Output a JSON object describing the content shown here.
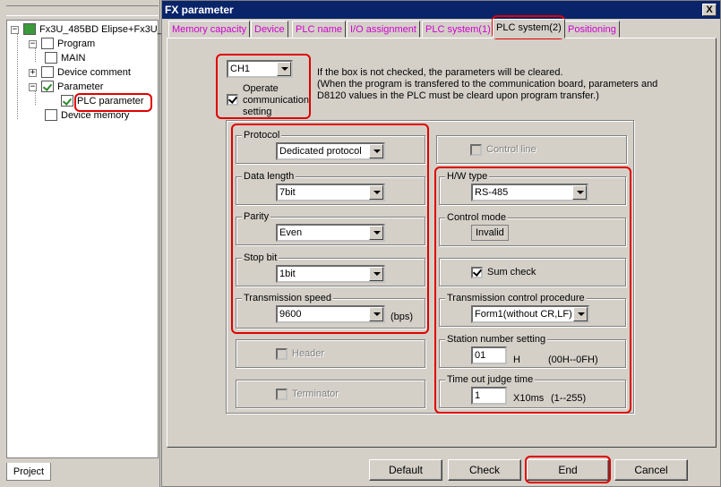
{
  "tree": {
    "root_label": "Fx3U_485BD Elipse+Fx3U_",
    "items": [
      {
        "label": "Program"
      },
      {
        "label": "MAIN"
      },
      {
        "label": "Device comment"
      },
      {
        "label": "Parameter"
      },
      {
        "label": "PLC parameter"
      },
      {
        "label": "Device memory"
      }
    ],
    "project_tab": "Project"
  },
  "dialog": {
    "title": "FX parameter",
    "close_glyph": "X",
    "tabs": [
      {
        "label": "Memory capacity"
      },
      {
        "label": "Device"
      },
      {
        "label": "PLC name"
      },
      {
        "label": "I/O assignment"
      },
      {
        "label": "PLC system(1)"
      },
      {
        "label": "PLC system(2)",
        "active": true
      },
      {
        "label": "Positioning"
      }
    ]
  },
  "channel": {
    "value": "CH1",
    "operate_label_1": "Operate",
    "operate_label_2": "communication",
    "operate_label_3": "setting",
    "operate_checked": true,
    "note_1": "If the box is not checked, the parameters will be cleared.",
    "note_2": "(When the program is transfered to the communication board, parameters and",
    "note_3": "D8120 values in the PLC must be cleard upon program transfer.)"
  },
  "left_settings": {
    "protocol": {
      "label": "Protocol",
      "value": "Dedicated protocol"
    },
    "data_length": {
      "label": "Data length",
      "value": "7bit"
    },
    "parity": {
      "label": "Parity",
      "value": "Even"
    },
    "stop_bit": {
      "label": "Stop bit",
      "value": "1bit"
    },
    "transmission_speed": {
      "label": "Transmission speed",
      "value": "9600",
      "unit": "(bps)"
    },
    "header": {
      "label": "Header",
      "checked": false
    },
    "terminator": {
      "label": "Terminator",
      "checked": false
    }
  },
  "right_settings": {
    "control_line": {
      "label": "Control line",
      "checked": false
    },
    "hw_type": {
      "label": "H/W type",
      "value": "RS-485"
    },
    "control_mode": {
      "label": "Control mode",
      "value": "Invalid"
    },
    "sum_check": {
      "label": "Sum check",
      "checked": true
    },
    "transmission_control": {
      "label": "Transmission control procedure",
      "value": "Form1(without CR,LF)"
    },
    "station_number": {
      "label": "Station number setting",
      "value": "01",
      "suffix": "H",
      "range": "(00H--0FH)"
    },
    "timeout": {
      "label": "Time out judge time",
      "value": "1",
      "unit": "X10ms",
      "range": "(1--255)"
    }
  },
  "buttons": {
    "default": "Default",
    "check": "Check",
    "end": "End",
    "cancel": "Cancel"
  },
  "colors": {
    "highlight": "#e00000",
    "tab_text": "#d000d0",
    "titlebar": "#0a246a"
  }
}
